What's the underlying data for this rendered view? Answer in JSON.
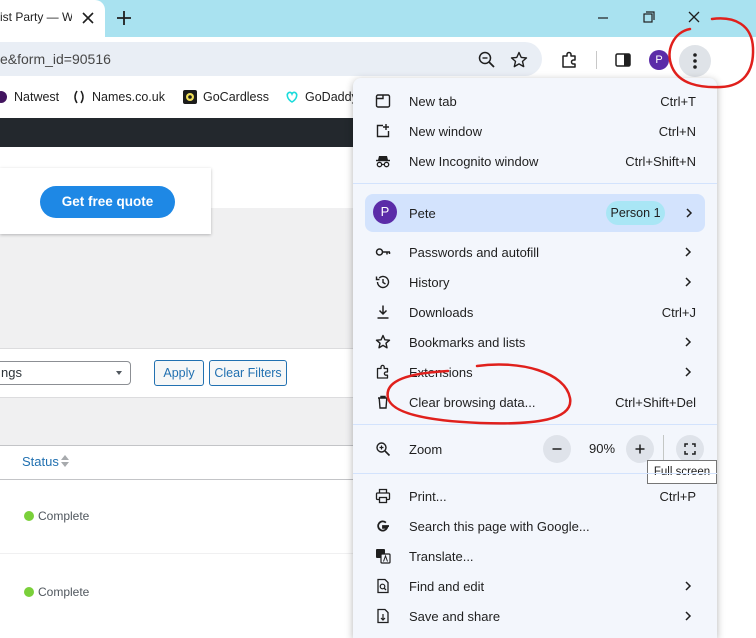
{
  "browser": {
    "tab_title": "ist Party — W",
    "url": "e&form_id=90516",
    "profile_initial": "P"
  },
  "bookmarks": [
    {
      "label": "Natwest"
    },
    {
      "label": "Names.co.uk"
    },
    {
      "label": "GoCardless"
    },
    {
      "label": "GoDaddy"
    }
  ],
  "page": {
    "quote_button": "Get free quote",
    "filter_select_value": "ngs",
    "apply_button": "Apply",
    "clear_filters_button": "Clear Filters",
    "status_header": "Status",
    "rows": [
      {
        "status": "Complete"
      },
      {
        "status": "Complete"
      }
    ],
    "status_color": "#7ad03a"
  },
  "menu": {
    "new_tab": {
      "label": "New tab",
      "shortcut": "Ctrl+T"
    },
    "new_window": {
      "label": "New window",
      "shortcut": "Ctrl+N"
    },
    "new_incognito": {
      "label": "New Incognito window",
      "shortcut": "Ctrl+Shift+N"
    },
    "profile": {
      "initial": "P",
      "name": "Pete",
      "badge": "Person 1"
    },
    "passwords": {
      "label": "Passwords and autofill"
    },
    "history": {
      "label": "History"
    },
    "downloads": {
      "label": "Downloads",
      "shortcut": "Ctrl+J"
    },
    "bookmarks": {
      "label": "Bookmarks and lists"
    },
    "extensions": {
      "label": "Extensions"
    },
    "clear_data": {
      "label": "Clear browsing data...",
      "shortcut": "Ctrl+Shift+Del"
    },
    "zoom": {
      "label": "Zoom",
      "value": "90%",
      "minus": "−",
      "plus": "+"
    },
    "fullscreen_tooltip": "Full screen",
    "print": {
      "label": "Print...",
      "shortcut": "Ctrl+P"
    },
    "search_google": {
      "label": "Search this page with Google..."
    },
    "translate": {
      "label": "Translate..."
    },
    "find_edit": {
      "label": "Find and edit"
    },
    "save_share": {
      "label": "Save and share"
    }
  },
  "annotation_color": "#e0201c"
}
